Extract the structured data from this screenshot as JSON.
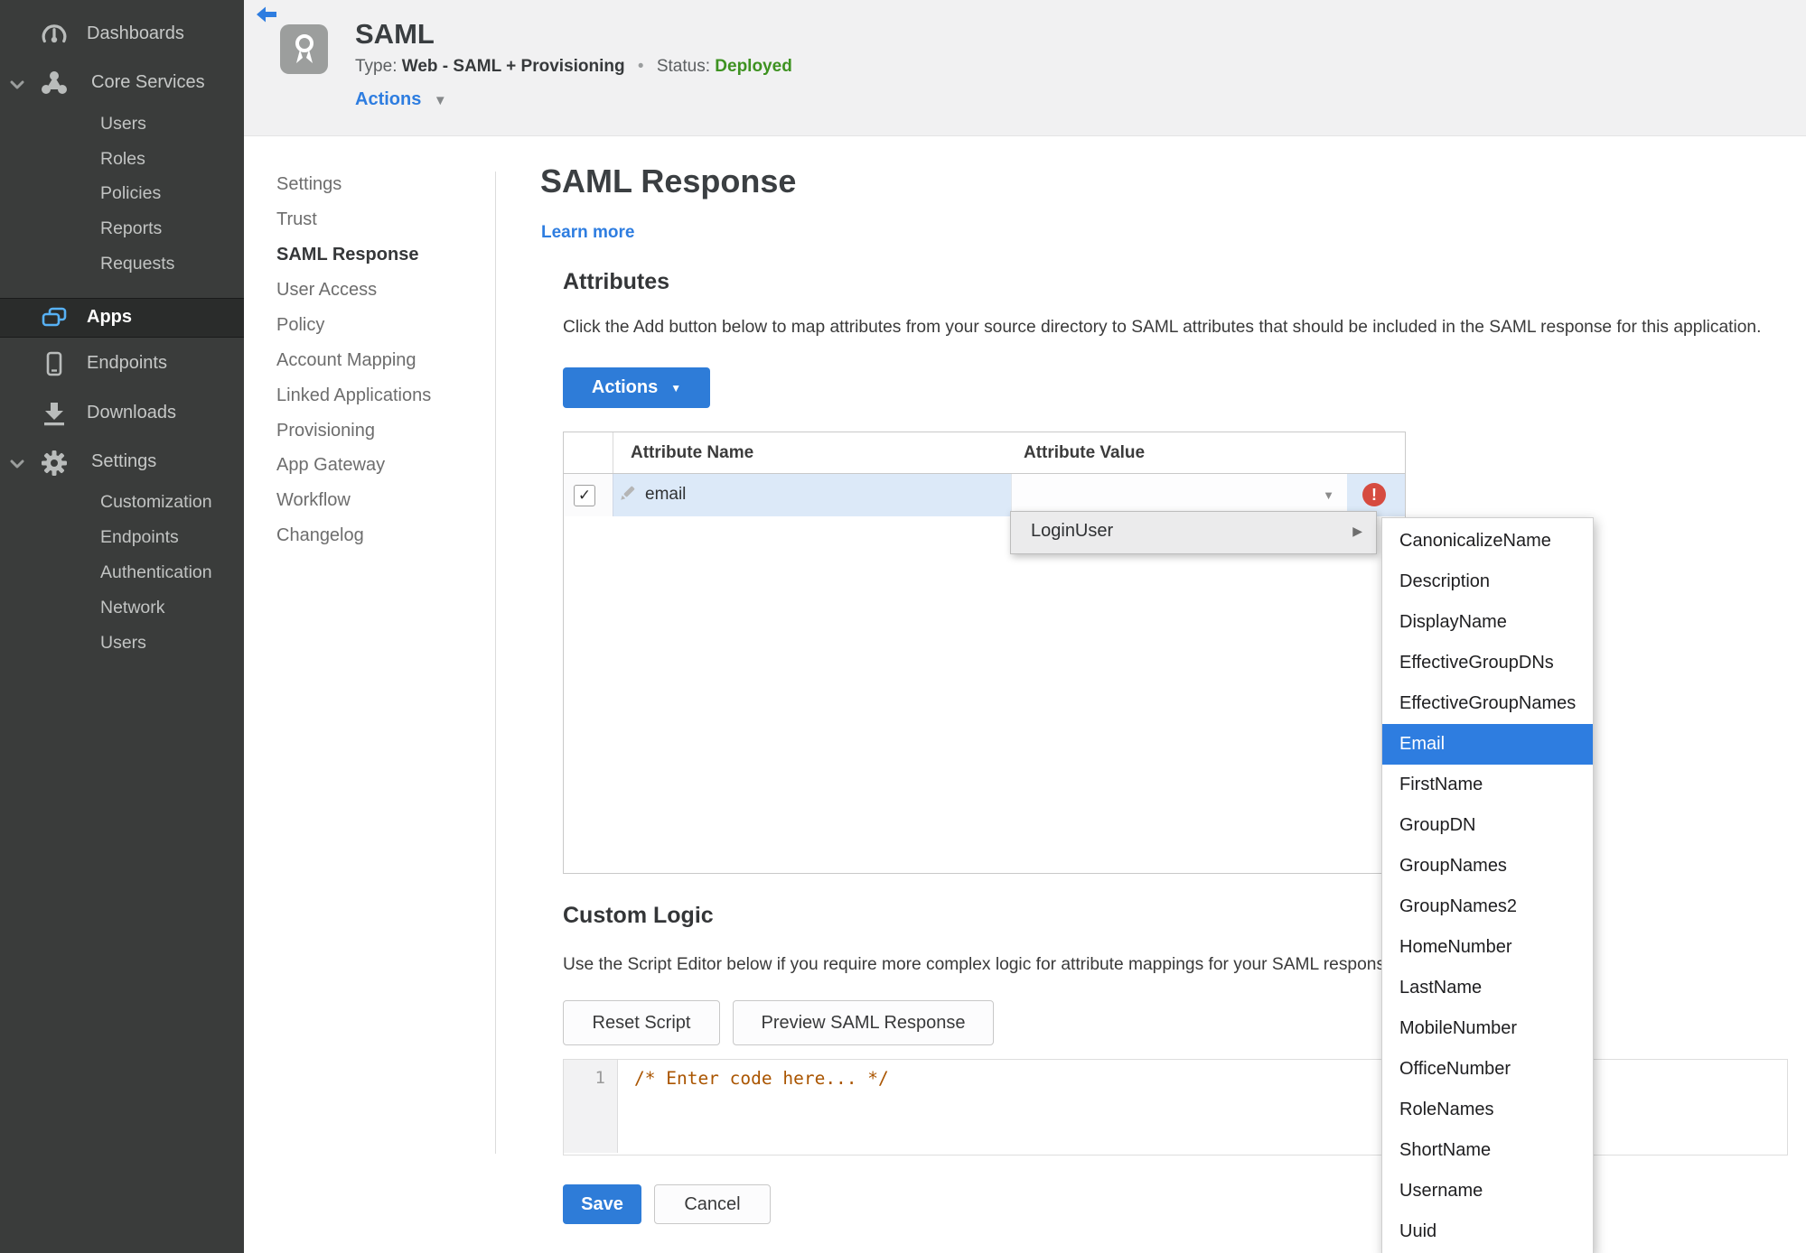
{
  "colors": {
    "accent_blue": "#2e7cd8",
    "link_blue": "#2e7de0",
    "status_green": "#3e9221",
    "error_red": "#d64b40",
    "row_highlight": "#dce9f8",
    "selection_blue": "#2e7de0",
    "sidebar_bg": "#3a3c3b"
  },
  "icons": {
    "caret_down": "▼",
    "submenu_arrow": "▶",
    "checkmark": "✓",
    "error_mark": "!",
    "dot_separator": "•"
  },
  "sidebar": {
    "items": [
      {
        "label": "Dashboards",
        "icon": "gauge-icon"
      },
      {
        "label": "Core Services",
        "icon": "core-services-icon",
        "expanded": true,
        "children": [
          "Users",
          "Roles",
          "Policies",
          "Reports",
          "Requests"
        ]
      },
      {
        "label": "Apps",
        "icon": "apps-icon",
        "active": true
      },
      {
        "label": "Endpoints",
        "icon": "endpoint-device-icon"
      },
      {
        "label": "Downloads",
        "icon": "download-icon"
      },
      {
        "label": "Settings",
        "icon": "gear-icon",
        "expanded": true,
        "children": [
          "Customization",
          "Endpoints",
          "Authentication",
          "Network",
          "Users"
        ]
      }
    ]
  },
  "header": {
    "title": "SAML",
    "type_label": "Type:",
    "type_value": "Web - SAML + Provisioning",
    "status_label": "Status:",
    "status_value": "Deployed",
    "actions_label": "Actions"
  },
  "secondary_nav": {
    "active": "SAML Response",
    "items": [
      "Settings",
      "Trust",
      "SAML Response",
      "User Access",
      "Policy",
      "Account Mapping",
      "Linked Applications",
      "Provisioning",
      "App Gateway",
      "Workflow",
      "Changelog"
    ]
  },
  "main": {
    "title": "SAML Response",
    "learn_more_label": "Learn more",
    "attributes": {
      "heading": "Attributes",
      "description": "Click the Add button below to map attributes from your source directory to SAML attributes that should be included in the SAML response for this application.",
      "actions_button_label": "Actions",
      "table": {
        "columns": [
          "Attribute Name",
          "Attribute Value"
        ],
        "rows": [
          {
            "checked": true,
            "name": "email",
            "value": ""
          }
        ]
      }
    },
    "value_menu": {
      "item_label": "LoginUser",
      "selected_option": "Email",
      "options": [
        "CanonicalizeName",
        "Description",
        "DisplayName",
        "EffectiveGroupDNs",
        "EffectiveGroupNames",
        "Email",
        "FirstName",
        "GroupDN",
        "GroupNames",
        "GroupNames2",
        "HomeNumber",
        "LastName",
        "MobileNumber",
        "OfficeNumber",
        "RoleNames",
        "ShortName",
        "Username",
        "Uuid"
      ]
    },
    "custom_logic": {
      "heading": "Custom Logic",
      "description": "Use the Script Editor below if you require more complex logic for attribute mappings for your SAML response.",
      "reset_button_label": "Reset Script",
      "preview_button_label": "Preview SAML Response",
      "editor": {
        "line_number": "1",
        "code": "/* Enter code here... */"
      }
    },
    "save_button_label": "Save",
    "cancel_button_label": "Cancel"
  }
}
